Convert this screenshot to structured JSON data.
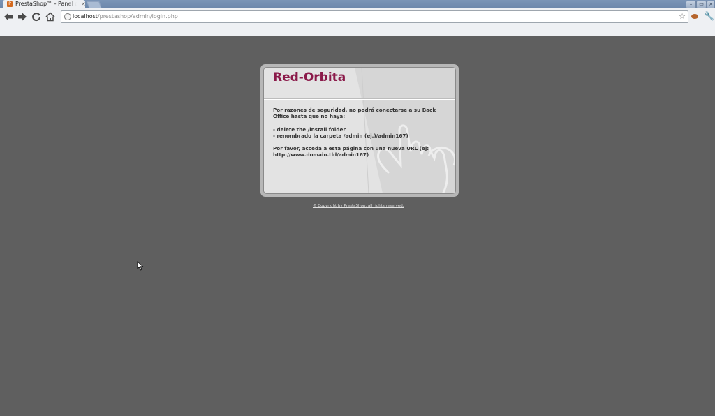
{
  "browser": {
    "tab_title": "PrestaShop™ - Panel d",
    "tab_close": "×",
    "url_host": "localhost",
    "url_path": "/prestashop/admin/login.php",
    "window_buttons": [
      "–",
      "▭",
      "×"
    ]
  },
  "page": {
    "site_name": "Red-Orbita",
    "message_intro": "Por razones de seguridad, no podrá conectarse a su Back Office hasta que no haya:",
    "steps": [
      "- delete the /install folder",
      "- renombrado la carpeta /admin (ej.)/admin167)"
    ],
    "message_outro": "Por favor, acceda a esta página con una nueva URL (ej: http://www.domain.tld/admin167)",
    "copyright": "© Copyright by PrestaShop. all rights reserved."
  },
  "colors": {
    "background": "#5f5f5f",
    "site_name": "#8b1a4a",
    "panel": "#e3e3e3"
  },
  "icons": {
    "favicon": "prestashop-favicon",
    "back": "back-arrow-icon",
    "forward": "forward-arrow-icon",
    "reload": "reload-icon",
    "home": "home-icon",
    "bookmark": "star-icon",
    "wrench": "wrench-icon"
  }
}
